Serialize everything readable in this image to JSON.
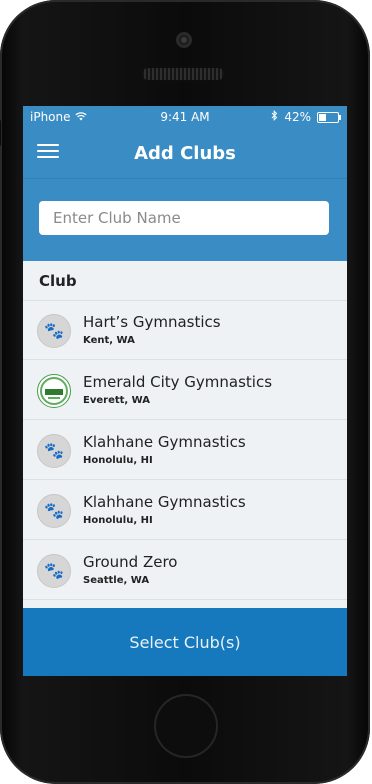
{
  "status_bar": {
    "carrier": "iPhone",
    "time": "9:41 AM",
    "battery": "42%"
  },
  "nav": {
    "title": "Add Clubs"
  },
  "search": {
    "placeholder": "Enter Club Name",
    "value": ""
  },
  "list": {
    "header": "Club",
    "clubs": [
      {
        "name": "Hart’s Gymnastics",
        "location": "Kent, WA",
        "logo": "paw-placeholder-icon"
      },
      {
        "name": "Emerald City Gymnastics",
        "location": "Everett, WA",
        "logo": "emerald-city-logo"
      },
      {
        "name": "Klahhane Gymnastics",
        "location": "Honolulu, HI",
        "logo": "paw-placeholder-icon"
      },
      {
        "name": "Klahhane Gymnastics",
        "location": "Honolulu, HI",
        "logo": "paw-placeholder-icon"
      },
      {
        "name": "Ground Zero",
        "location": "Seattle, WA",
        "logo": "paw-placeholder-icon"
      }
    ]
  },
  "footer": {
    "select_label": "Select Club(s)"
  },
  "colors": {
    "header_blue": "#3a8dc4",
    "button_blue": "#1679bd",
    "list_background": "#eef2f5"
  }
}
